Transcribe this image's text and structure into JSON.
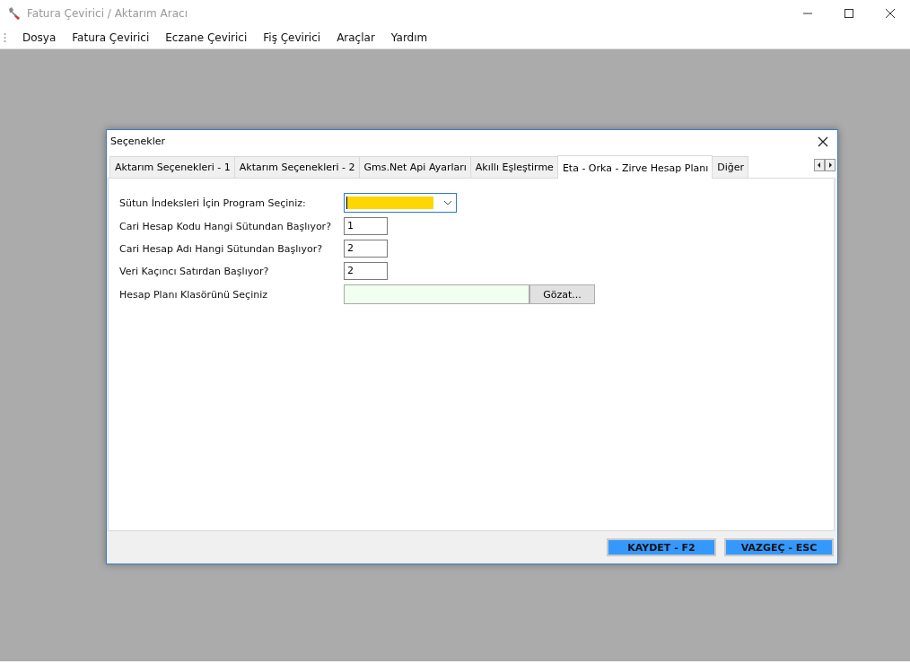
{
  "window": {
    "title": "Fatura Çevirici / Aktarım Aracı"
  },
  "menu": [
    "Dosya",
    "Fatura Çevirici",
    "Eczane Çevirici",
    "Fiş Çevirici",
    "Araçlar",
    "Yardım"
  ],
  "dialog": {
    "title": "Seçenekler",
    "tabs": [
      {
        "label": "Aktarım Seçenekleri - 1",
        "selected": false
      },
      {
        "label": "Aktarım Seçenekleri - 2",
        "selected": false
      },
      {
        "label": "Gms.Net Api Ayarları",
        "selected": false
      },
      {
        "label": "Akıllı Eşleştirme",
        "selected": false
      },
      {
        "label": "Eta - Orka - Zirve Hesap Planı",
        "selected": true
      },
      {
        "label": "Diğer",
        "selected": false
      }
    ],
    "fields": [
      {
        "kind": "combo",
        "label": "Sütun İndeksleri İçin Program Seçiniz:"
      },
      {
        "kind": "text",
        "label": "Cari Hesap Kodu Hangi Sütundan Başlıyor?",
        "value": "1"
      },
      {
        "kind": "text",
        "label": "Cari Hesap Adı Hangi Sütundan Başlıyor?",
        "value": "2"
      },
      {
        "kind": "text",
        "label": "Veri Kaçıncı Satırdan Başlıyor?",
        "value": "2"
      },
      {
        "kind": "folder",
        "label": "Hesap Planı Klasörünü Seçiniz",
        "button": "Gözat..."
      }
    ],
    "buttons": [
      "KAYDET - F2",
      "VAZGEÇ - ESC"
    ]
  }
}
